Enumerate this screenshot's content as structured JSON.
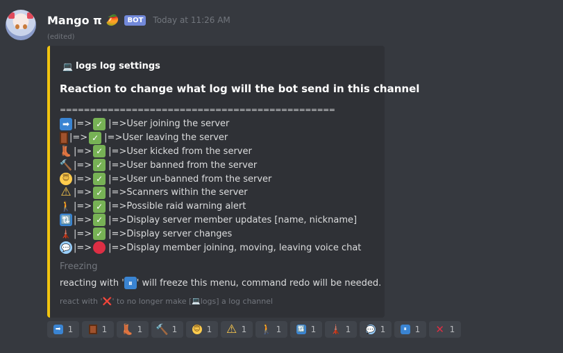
{
  "message": {
    "username": "Mango π",
    "name_emoji": "🥭",
    "bot_tag": "BOT",
    "timestamp": "Today at 11:26 AM",
    "edited": "(edited)"
  },
  "embed": {
    "accent_color": "#f1c40f",
    "author_icon": "💻",
    "author": "logs log settings",
    "title": "Reaction to change what log will the bot send in this channel",
    "divider": "==============================================",
    "separator": "|=>",
    "rows": [
      {
        "icon": "arrow-right-icon",
        "glyph": "➡",
        "style": "ic-blue",
        "status": "check",
        "label": "|=>User joining the server"
      },
      {
        "icon": "door-icon",
        "glyph": "",
        "style": "ic-door",
        "status": "check",
        "label": "|=>User leaving the server"
      },
      {
        "icon": "boot-icon",
        "glyph": "👢",
        "style": "ic-boot",
        "status": "check",
        "label": "|=>User kicked from the server"
      },
      {
        "icon": "hammer-icon",
        "glyph": "🔨",
        "style": "ic-hammer",
        "status": "check",
        "label": "|=>User banned from the server"
      },
      {
        "icon": "angel-icon",
        "glyph": "😇",
        "style": "ic-angel",
        "status": "check",
        "label": "|=>User un-banned from the server"
      },
      {
        "icon": "warning-icon",
        "glyph": "⚠",
        "style": "ic-warn",
        "status": "check",
        "label": "|=>Scanners within the server"
      },
      {
        "icon": "walking-person-icon",
        "glyph": "🚶",
        "style": "ic-walk",
        "status": "check",
        "label": "|=>Possible raid warning alert"
      },
      {
        "icon": "refresh-icon",
        "glyph": "🔃",
        "style": "ic-blue",
        "status": "check",
        "label": "|=>Display server member updates [name, nickname]"
      },
      {
        "icon": "tower-icon",
        "glyph": "🗼",
        "style": "ic-tower",
        "status": "check",
        "label": "|=>Display server changes"
      },
      {
        "icon": "speech-bubble-icon",
        "glyph": "💬",
        "style": "ic-speech",
        "status": "stop",
        "label": "|=>Display member joining, moving, leaving voice chat"
      }
    ],
    "field_name": "Freezing",
    "field_value_before": "reacting with '",
    "field_value_emoji": "⏸",
    "field_value_after": "' will freeze this menu, command redo will be needed.",
    "footer_before": "react with '",
    "footer_emoji": "❌",
    "footer_middle": "' to no longer make [",
    "footer_icon": "💻",
    "footer_after": " logs] a log channel"
  },
  "reactions": [
    {
      "icon": "arrow-right-icon",
      "glyph": "➡",
      "style": "ic-blue",
      "count": "1"
    },
    {
      "icon": "door-icon",
      "glyph": "",
      "style": "ic-door",
      "count": "1"
    },
    {
      "icon": "boot-icon",
      "glyph": "👢",
      "style": "ic-boot",
      "count": "1"
    },
    {
      "icon": "hammer-icon",
      "glyph": "🔨",
      "style": "ic-hammer",
      "count": "1"
    },
    {
      "icon": "angel-icon",
      "glyph": "😇",
      "style": "ic-angel",
      "count": "1"
    },
    {
      "icon": "warning-icon",
      "glyph": "⚠",
      "style": "ic-warn",
      "count": "1"
    },
    {
      "icon": "walking-person-icon",
      "glyph": "🚶",
      "style": "ic-walk",
      "count": "1"
    },
    {
      "icon": "refresh-icon",
      "glyph": "🔃",
      "style": "ic-blue",
      "count": "1"
    },
    {
      "icon": "tower-icon",
      "glyph": "🗼",
      "style": "ic-tower",
      "count": "1"
    },
    {
      "icon": "speech-bubble-icon",
      "glyph": "💬",
      "style": "ic-speech",
      "count": "1"
    },
    {
      "icon": "pause-icon",
      "glyph": "⏸",
      "style": "ic-blue",
      "count": "1"
    },
    {
      "icon": "cross-mark-icon",
      "glyph": "✕",
      "style": "ic-x",
      "count": "1"
    }
  ]
}
